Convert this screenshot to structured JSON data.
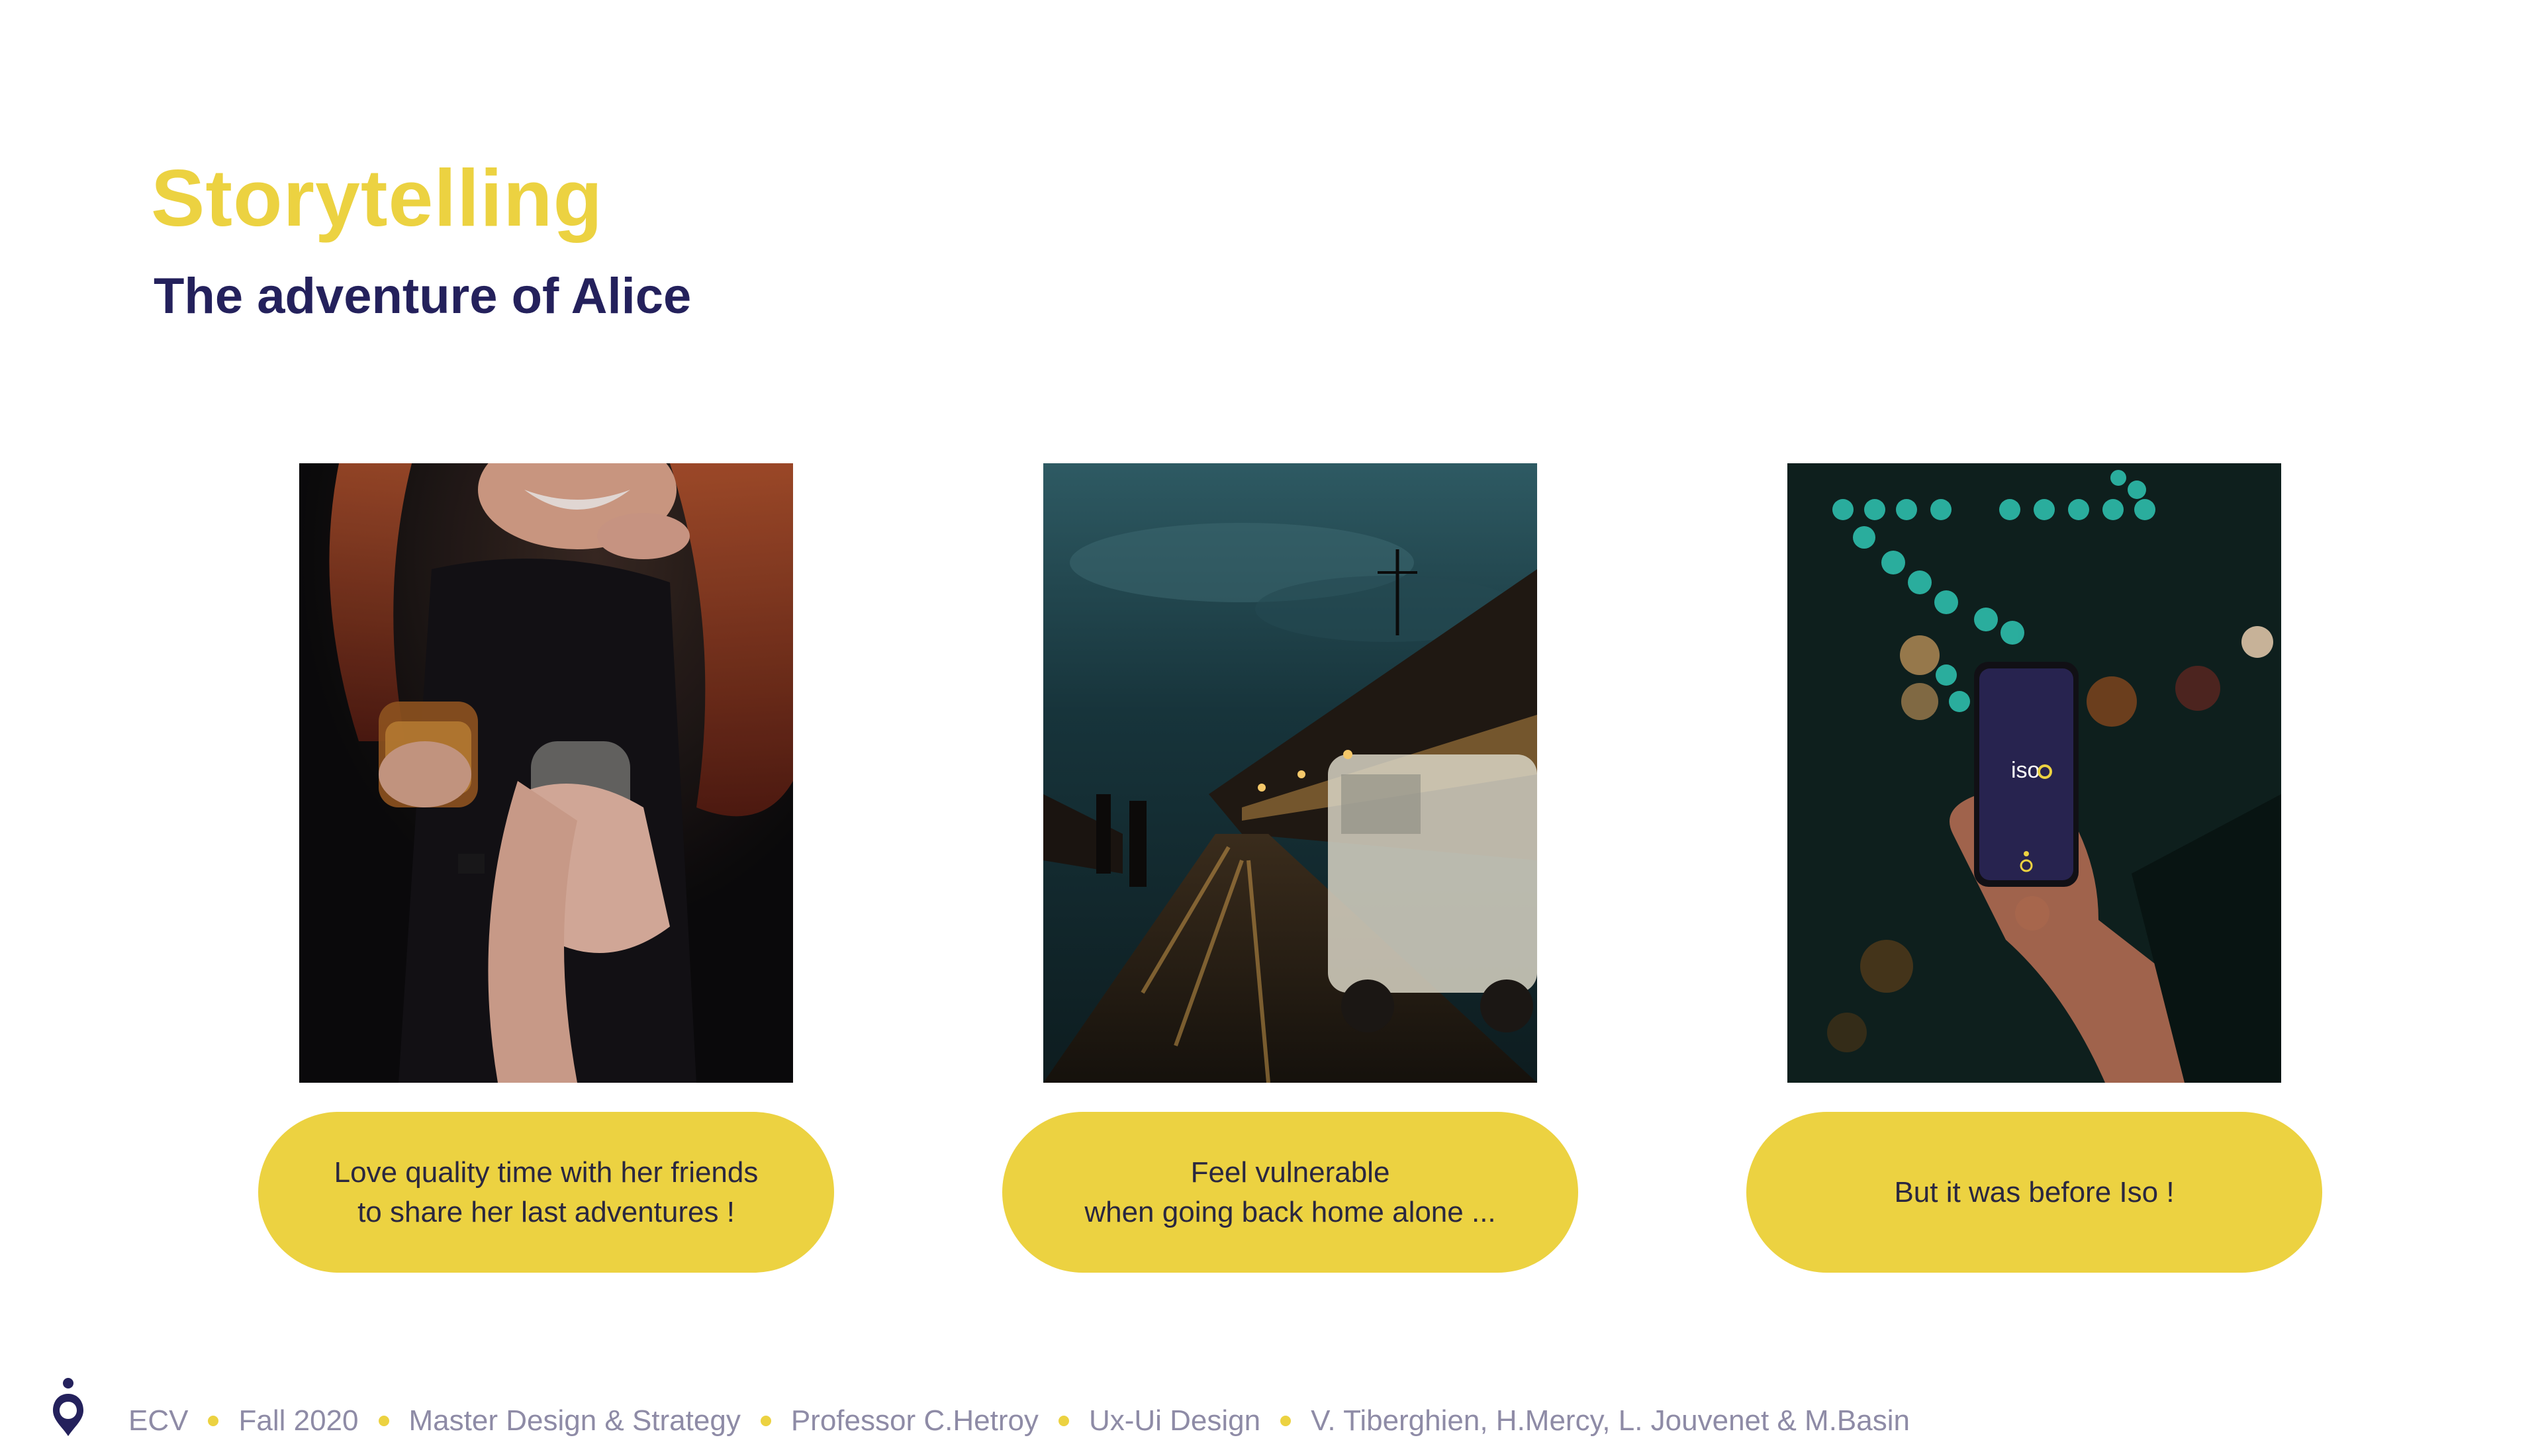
{
  "header": {
    "title": "Storytelling",
    "subtitle": "The adventure of Alice"
  },
  "colors": {
    "accent_yellow": "#ECD241",
    "navy": "#24215C",
    "footer_text": "#8E8BA6"
  },
  "cards": [
    {
      "image": "friends-drinks-photo",
      "caption_lines": [
        "Love quality time with her friends",
        "to share her last adventures !"
      ]
    },
    {
      "image": "night-street-photo",
      "caption_lines": [
        "Feel vulnerable",
        "when going back home alone ..."
      ]
    },
    {
      "image": "phone-iso-app-photo",
      "caption_lines": [
        "But it was before Iso !"
      ],
      "phone_logo": "iso"
    }
  ],
  "footer": {
    "logo_icon": "location-pin-icon",
    "items": [
      "ECV",
      "Fall 2020",
      "Master Design & Strategy",
      "Professor C.Hetroy",
      "Ux-Ui Design",
      "V. Tiberghien, H.Mercy, L. Jouvenet & M.Basin"
    ]
  }
}
